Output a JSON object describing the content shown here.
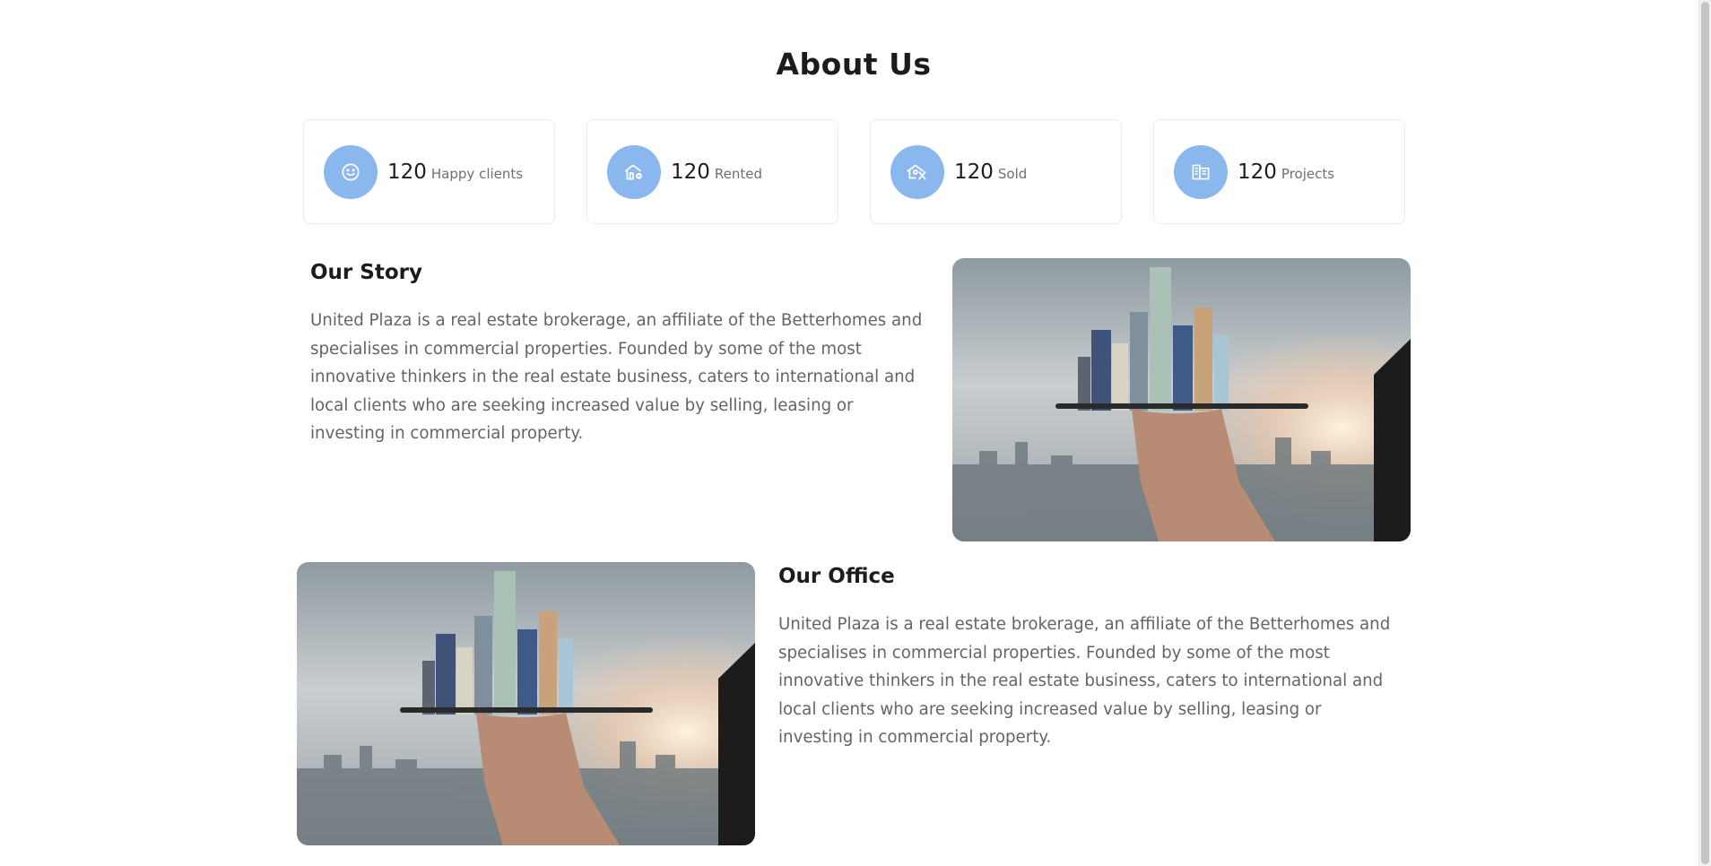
{
  "page": {
    "title": "About Us"
  },
  "stats": [
    {
      "number": "120",
      "label": "Happy clients",
      "icon": "smile-icon"
    },
    {
      "number": "120",
      "label": "Rented",
      "icon": "house-key-icon"
    },
    {
      "number": "120",
      "label": "Sold",
      "icon": "house-sold-icon"
    },
    {
      "number": "120",
      "label": "Projects",
      "icon": "buildings-icon"
    }
  ],
  "story": {
    "heading": "Our Story",
    "body": "United Plaza is a real estate brokerage, an affiliate of the Betterhomes and specialises in commercial properties. Founded by some of the most innovative thinkers in the real estate business, caters to international and local clients who are seeking increased value by selling, leasing or investing in commercial property."
  },
  "office": {
    "heading": "Our Office",
    "body": "United Plaza is a real estate brokerage, an affiliate of the Betterhomes and specialises in commercial properties. Founded by some of the most innovative thinkers in the real estate business, caters to international and local clients who are seeking increased value by selling, leasing or investing in commercial property."
  },
  "colors": {
    "accent": "#8ab8ee",
    "heading": "#1c1c1c",
    "body_text": "#646464",
    "card_border": "#ececec"
  }
}
